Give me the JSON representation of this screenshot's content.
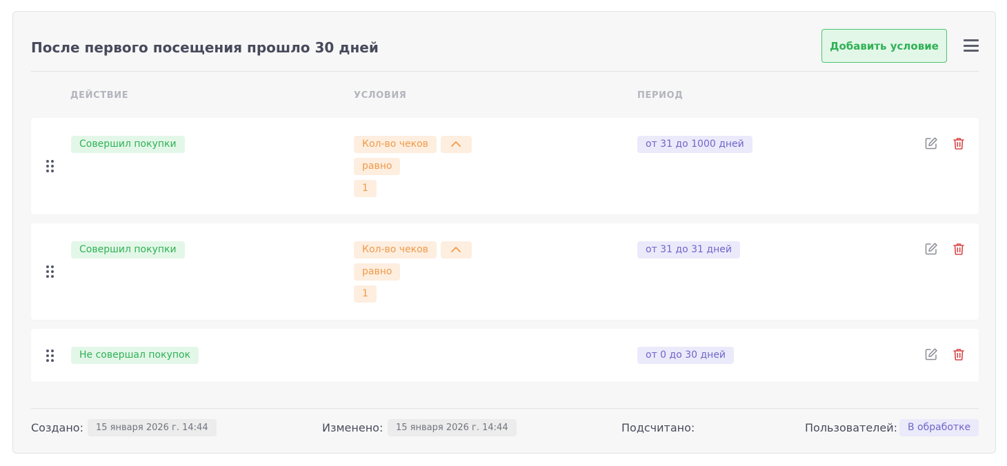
{
  "header": {
    "title": "После первого посещения прошло 30 дней",
    "add_button": "Добавить условие"
  },
  "columns": {
    "action": "ДЕЙСТВИЕ",
    "conditions": "УСЛОВИЯ",
    "period": "ПЕРИОД"
  },
  "rows": [
    {
      "action": "Совершил покупки",
      "condition_field": "Кол-во чеков",
      "condition_operator": "равно",
      "condition_value": "1",
      "period": "от 31 до 1000 дней"
    },
    {
      "action": "Совершил покупки",
      "condition_field": "Кол-во чеков",
      "condition_operator": "равно",
      "condition_value": "1",
      "period": "от 31 до 31 дней"
    },
    {
      "action": "Не совершал покупок",
      "period": "от 0 до 30 дней"
    }
  ],
  "footer": {
    "created_label": "Создано:",
    "created_value": "15 января 2026 г. 14:44",
    "modified_label": "Изменено:",
    "modified_value": "15 января 2026 г. 14:44",
    "counted_label": "Подсчитано:",
    "users_label": "Пользователей:",
    "users_value": "В обработке"
  },
  "colors": {
    "green": "#2fb155",
    "orange": "#f09a4a",
    "purple": "#6e65c9",
    "red": "#d64545"
  },
  "icons": [
    "menu-icon",
    "drag-handle-icon",
    "chevron-up-icon",
    "edit-icon",
    "trash-icon"
  ]
}
